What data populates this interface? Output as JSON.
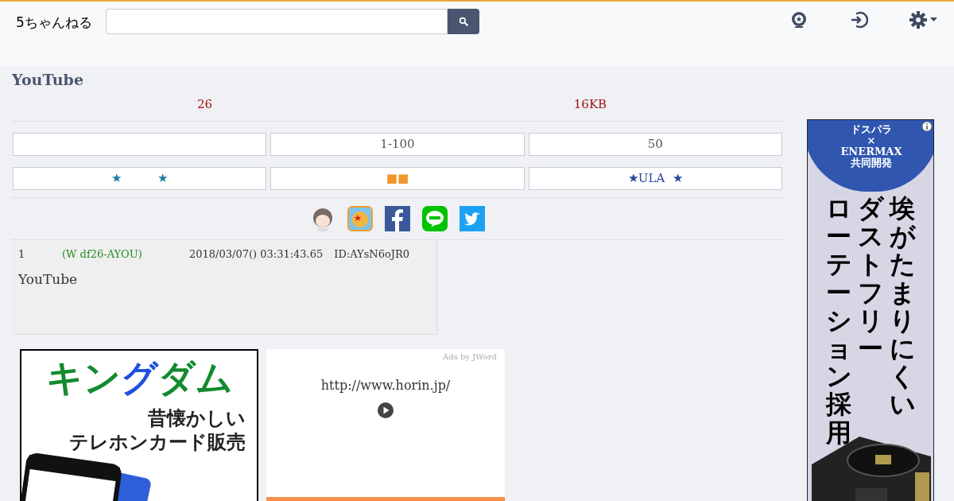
{
  "header": {
    "logo": "5ちゃんねる"
  },
  "thread": {
    "title": "YouTube",
    "replies": "26",
    "size": "16KB"
  },
  "nav_buttons": [
    {
      "kind": "blank"
    },
    {
      "kind": "text",
      "label": "1-100"
    },
    {
      "kind": "text",
      "label": "50"
    }
  ],
  "link_buttons": [
    {
      "label": "★　　　★",
      "color": "#1a7fa0"
    },
    {
      "label": "■■",
      "color": "#f0962a"
    },
    {
      "label": "★ULA  ★",
      "color": "#2a4a9a"
    }
  ],
  "post": {
    "number": "1",
    "name": "(W df26-AYOU)",
    "date": "2018/03/07() 03:31:43.65",
    "id": "ID:AYsN6oJR0",
    "body": "YouTube"
  },
  "ad_left": {
    "title": [
      "キン",
      "グ",
      "ダム"
    ],
    "lines": [
      "昔懐かしい",
      "テレホンカード販売"
    ]
  },
  "ad_middle": {
    "credit": "Ads by JWord",
    "url": "http://www.horin.jp/"
  },
  "ad_right": {
    "top": [
      "ドスパラ",
      "×",
      "ENERMAX",
      "共同開発"
    ],
    "columns": [
      "ローテーション採用",
      "ダストフリー",
      "埃がたまりにくい"
    ]
  }
}
